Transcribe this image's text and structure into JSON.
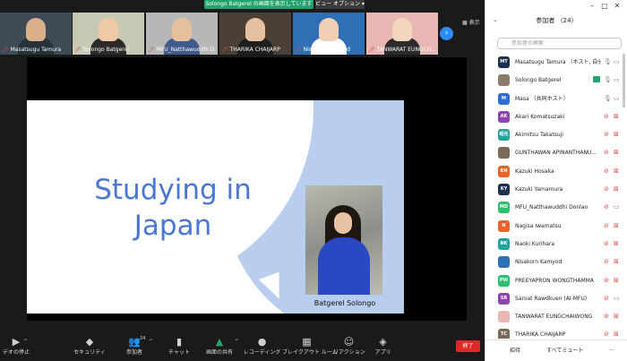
{
  "banner": {
    "sharing_text": "Solongo  Batgerel の画面を表示しています",
    "view_options": "ビュー オプション ▾",
    "display_toggle": "表示"
  },
  "gallery": {
    "tiles": [
      {
        "name": "Masatsugu Tamura",
        "bg": "#3e4a55",
        "skin": "#d9b08c",
        "body": "#263238"
      },
      {
        "name": "Solongo Batgerel",
        "bg": "#c7c9b5",
        "skin": "#f0caa8",
        "body": "#2f2a2a"
      },
      {
        "name": "MFU_Natthawuddhi D...",
        "bg": "#b7b7b7",
        "skin": "#e4c09c",
        "body": "#3f5b8b"
      },
      {
        "name": "THARIKA CHAIJARP",
        "bg": "#4a4038",
        "skin": "#e6c0a0",
        "body": "#1e1e1e"
      },
      {
        "name": "Nisakorn Kamyod",
        "bg": "#2e6fb5",
        "skin": "#f1cfb2",
        "body": "#ffffff"
      },
      {
        "name": "TANWARAT EUNGCH...",
        "bg": "#e9b7b3",
        "skin": "#f4d5bd",
        "body": "#2b2b2b"
      }
    ],
    "next_icon": "›"
  },
  "slide": {
    "title": "Studying in\nJapan",
    "caption": "Batgerel Solongo"
  },
  "toolbar": {
    "items": [
      {
        "id": "video",
        "icon": "▶",
        "label": "デオの停止"
      },
      {
        "id": "security",
        "icon": "◆",
        "label": "セキュリティ"
      },
      {
        "id": "participants",
        "icon": "👥",
        "label": "参加者",
        "badge": "24"
      },
      {
        "id": "chat",
        "icon": "▮",
        "label": "チャット"
      },
      {
        "id": "share",
        "icon": "▲",
        "label": "画面の共有"
      },
      {
        "id": "record",
        "icon": "●",
        "label": "レコーディング"
      },
      {
        "id": "breakout",
        "icon": "▦",
        "label": "ブレイクアウト ルーム"
      },
      {
        "id": "reactions",
        "icon": "☺",
        "label": "リアクション"
      },
      {
        "id": "apps",
        "icon": "◈",
        "label": "アプリ"
      }
    ],
    "end_label": "終了"
  },
  "panel": {
    "title": "参加者 （24）",
    "search_placeholder": "参加者の検索",
    "participants": [
      {
        "initials": "MT",
        "color": "#1e3050",
        "name": "Masatsugu Tamura （ホスト, 自分）",
        "mic": "on",
        "cam": "on"
      },
      {
        "initials": "",
        "color": "#8a7a6a",
        "name": "Solongo Batgerel",
        "mic": "on",
        "cam": "on",
        "sharing": true
      },
      {
        "initials": "M",
        "color": "#2d6fd6",
        "name": "Masa （共同ホスト）",
        "mic": "on",
        "cam": "on"
      },
      {
        "initials": "AK",
        "color": "#8e44ad",
        "name": "Akari Komatsuzaki",
        "mic": "off",
        "cam": "off"
      },
      {
        "initials": "昭光",
        "color": "#20a39e",
        "name": "Akimitsu Takatsuji",
        "mic": "off",
        "cam": "off"
      },
      {
        "initials": "",
        "color": "#7c6a58",
        "name": "GUNTHAWAN APINANTHANU...",
        "mic": "off",
        "cam": "off"
      },
      {
        "initials": "KH",
        "color": "#e8632b",
        "name": "Kazuki Hosaka",
        "mic": "off",
        "cam": "off"
      },
      {
        "initials": "KY",
        "color": "#1e3050",
        "name": "Kazuki Yamamura",
        "mic": "off",
        "cam": "off"
      },
      {
        "initials": "MD",
        "color": "#2fbf71",
        "name": "MFU_Natthawuddhi Donlao",
        "mic": "off",
        "cam": "on"
      },
      {
        "initials": "N",
        "color": "#e8632b",
        "name": "Nagisa   Iwamatsu",
        "mic": "off",
        "cam": "off"
      },
      {
        "initials": "NK",
        "color": "#20a39e",
        "name": "Naoki Kurihara",
        "mic": "off",
        "cam": "off"
      },
      {
        "initials": "",
        "color": "#2e6fb5",
        "name": "Nisakorn Kamyod",
        "mic": "off",
        "cam": "off"
      },
      {
        "initials": "PW",
        "color": "#2fbf71",
        "name": "PREEYAPRON WONGTHAMMA",
        "mic": "off",
        "cam": "off"
      },
      {
        "initials": "SR",
        "color": "#8e44ad",
        "name": "Saroat Rawdkuen (AI-MFU)",
        "mic": "off",
        "cam": "on"
      },
      {
        "initials": "",
        "color": "#e9b7b3",
        "name": "TANWARAT EUNGCHAIWONG",
        "mic": "off",
        "cam": "off"
      },
      {
        "initials": "TC",
        "color": "#7c6a58",
        "name": "THARIKA CHAIJARP",
        "mic": "off",
        "cam": "off"
      }
    ],
    "invite_label": "招待",
    "mute_all_label": "すべてミュート",
    "more_label": "..."
  }
}
